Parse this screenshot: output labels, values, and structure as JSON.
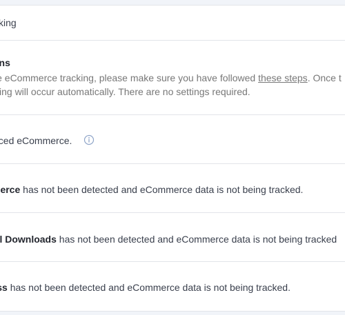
{
  "header": {
    "title_fragment": "cking"
  },
  "instructions": {
    "title_fragment": "ons",
    "line1_before_link": "le eCommerce tracking, please make sure you have followed ",
    "link_text": "these steps",
    "line1_after_link": ". Once t",
    "line2": "king will occur automatically. There are no settings required."
  },
  "enhanced": {
    "text_fragment": "nced eCommerce.",
    "icon": "info-icon"
  },
  "plugins": [
    {
      "name_fragment": "merce",
      "status": " has not been detected and eCommerce data is not being tracked."
    },
    {
      "name_fragment": "tal Downloads",
      "status": " has not been detected and eCommerce data is not being tracked"
    },
    {
      "name_fragment": "ress",
      "status": " has not been detected and eCommerce data is not being tracked."
    }
  ],
  "colors": {
    "page_background": "#f1f4f9",
    "panel_background": "#ffffff",
    "divider": "#e2e4e9",
    "muted_text": "#777777",
    "icon": "#8ea4c8"
  }
}
